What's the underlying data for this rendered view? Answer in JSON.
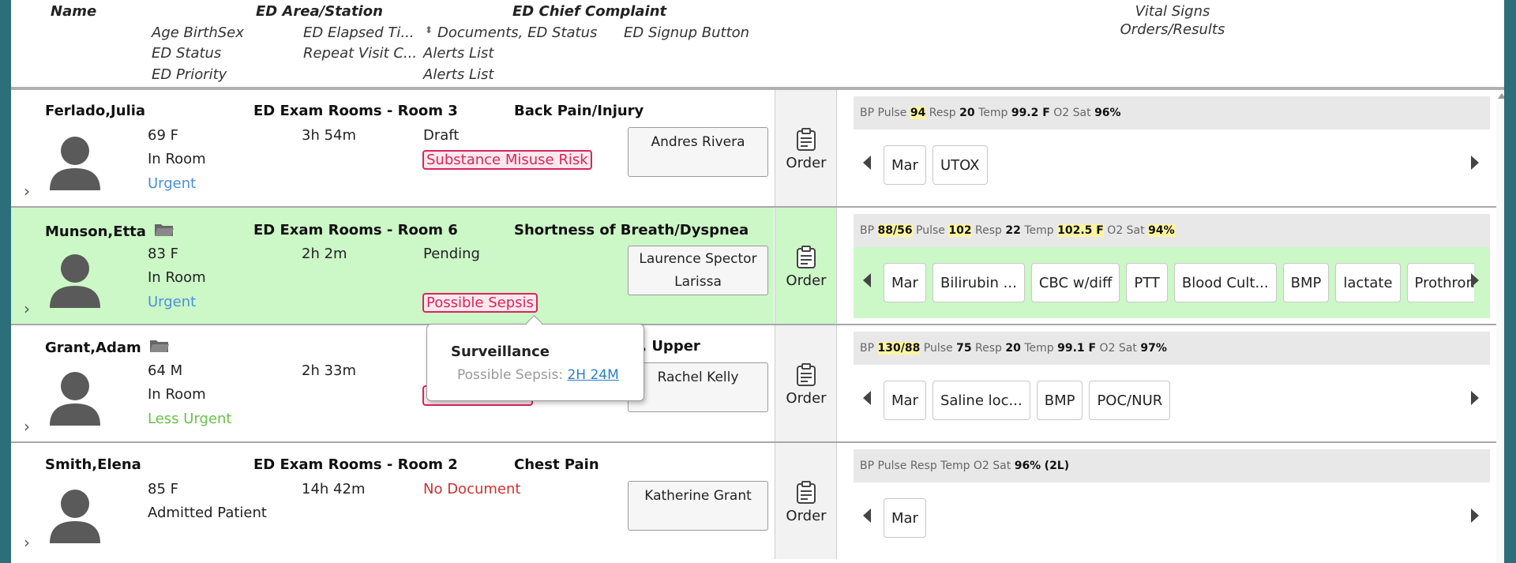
{
  "header": {
    "name": "Name",
    "area": "ED Area/Station",
    "complaint": "ED Chief Complaint",
    "age_sex": "Age BirthSex",
    "elapsed": "ED Elapsed Ti...",
    "documents": "Documents, ED Status",
    "signup": "ED Signup Button",
    "ed_status": "ED Status",
    "repeat_visit": "Repeat Visit C...",
    "alerts1": "Alerts List",
    "ed_priority": "ED Priority",
    "alerts2": "Alerts List",
    "vital_signs": "Vital Signs",
    "orders_results": "Orders/Results"
  },
  "order_label": "Order",
  "patients": [
    {
      "name": "Ferlado,Julia",
      "area": "ED Exam Rooms - Room 3",
      "complaint": "Back Pain/Injury",
      "age_sex": "69 F",
      "elapsed": "3h 54m",
      "doc_status": "Draft",
      "status": "In Room",
      "priority": "Urgent",
      "alert": "Substance Misuse Risk",
      "provider": "Andres Rivera",
      "vitals": {
        "bp_label": "BP",
        "pulse_label": "Pulse",
        "pulse": "94",
        "resp_label": "Resp",
        "resp": "20",
        "temp_label": "Temp",
        "temp": "99.2 F",
        "o2_label": "O2 Sat",
        "o2": "96%"
      },
      "orders": [
        "Mar",
        "UTOX"
      ]
    },
    {
      "name": "Munson,Etta",
      "area": "ED Exam Rooms - Room 6",
      "complaint": "Shortness of Breath/Dyspnea",
      "age_sex": "83 F",
      "elapsed": "2h 2m",
      "doc_status": "Pending",
      "status": "In Room",
      "priority": "Urgent",
      "alert": "Possible Sepsis",
      "provider": "Laurence Spector",
      "provider2": "Larissa",
      "vitals": {
        "bp_label": "BP",
        "bp": "88/56",
        "pulse_label": "Pulse",
        "pulse": "102",
        "resp_label": "Resp",
        "resp": "22",
        "temp_label": "Temp",
        "temp": "102.5 F",
        "o2_label": "O2 Sat",
        "o2": "94%"
      },
      "orders": [
        "Mar",
        "Bilirubin ...",
        "CBC w/diff",
        "PTT",
        "Blood Cult...",
        "BMP",
        "lactate",
        "Prothromb"
      ]
    },
    {
      "name": "Grant,Adam",
      "complaint_partial": "ry, Upper",
      "age_sex": "64 M",
      "elapsed": "2h 33m",
      "status": "In Room",
      "priority": "Less Urgent",
      "provider": "Rachel Kelly",
      "vitals": {
        "bp_label": "BP",
        "bp": "130/88",
        "pulse_label": "Pulse",
        "pulse": "75",
        "resp_label": "Resp",
        "resp": "20",
        "temp_label": "Temp",
        "temp": "99.1 F",
        "o2_label": "O2 Sat",
        "o2": "97%"
      },
      "orders": [
        "Mar",
        "Saline loc...",
        "BMP",
        "POC/NUR"
      ]
    },
    {
      "name": "Smith,Elena",
      "area": "ED Exam Rooms - Room 2",
      "complaint": "Chest Pain",
      "age_sex": "85 F",
      "elapsed": "14h 42m",
      "doc_status": "No Document",
      "status": "Admitted Patient",
      "provider": "Katherine Grant",
      "vitals": {
        "labels": "BP Pulse Resp Temp O2 Sat",
        "o2": "96%",
        "o2_extra": "(2L)"
      },
      "orders": [
        "Mar"
      ]
    }
  ],
  "tooltip": {
    "title": "Surveillance",
    "label": "Possible Sepsis:",
    "link": "2H 24M"
  },
  "colors": {
    "selected_row": "#ccf7c7",
    "alert": "#d9265a",
    "urgent": "#4a90d9",
    "less_urgent": "#6cc04a",
    "no_document": "#d03030"
  }
}
